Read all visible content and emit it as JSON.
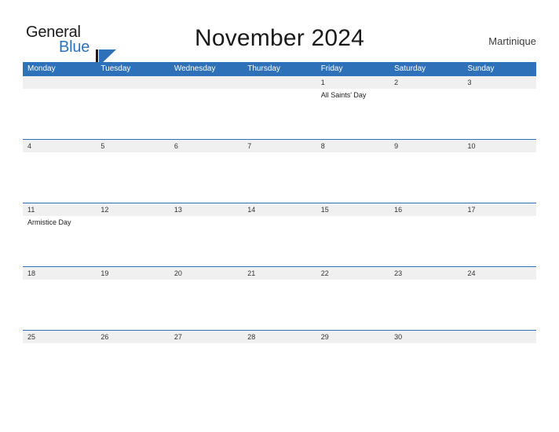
{
  "brand": {
    "name_part1": "General",
    "name_part2": "Blue",
    "logo_icon": "general-blue-triangle-logo",
    "accent_color": "#2e71b8"
  },
  "header": {
    "title": "November 2024",
    "location": "Martinique"
  },
  "calendar": {
    "weekday_headers": [
      "Monday",
      "Tuesday",
      "Wednesday",
      "Thursday",
      "Friday",
      "Saturday",
      "Sunday"
    ],
    "header_bg": "#2e71b8",
    "number_band_bg": "#f0f0f0",
    "weeks": [
      {
        "days": [
          {
            "number": "",
            "event": ""
          },
          {
            "number": "",
            "event": ""
          },
          {
            "number": "",
            "event": ""
          },
          {
            "number": "",
            "event": ""
          },
          {
            "number": "1",
            "event": "All Saints' Day"
          },
          {
            "number": "2",
            "event": ""
          },
          {
            "number": "3",
            "event": ""
          }
        ]
      },
      {
        "days": [
          {
            "number": "4",
            "event": ""
          },
          {
            "number": "5",
            "event": ""
          },
          {
            "number": "6",
            "event": ""
          },
          {
            "number": "7",
            "event": ""
          },
          {
            "number": "8",
            "event": ""
          },
          {
            "number": "9",
            "event": ""
          },
          {
            "number": "10",
            "event": ""
          }
        ]
      },
      {
        "days": [
          {
            "number": "11",
            "event": "Armistice Day"
          },
          {
            "number": "12",
            "event": ""
          },
          {
            "number": "13",
            "event": ""
          },
          {
            "number": "14",
            "event": ""
          },
          {
            "number": "15",
            "event": ""
          },
          {
            "number": "16",
            "event": ""
          },
          {
            "number": "17",
            "event": ""
          }
        ]
      },
      {
        "days": [
          {
            "number": "18",
            "event": ""
          },
          {
            "number": "19",
            "event": ""
          },
          {
            "number": "20",
            "event": ""
          },
          {
            "number": "21",
            "event": ""
          },
          {
            "number": "22",
            "event": ""
          },
          {
            "number": "23",
            "event": ""
          },
          {
            "number": "24",
            "event": ""
          }
        ]
      },
      {
        "days": [
          {
            "number": "25",
            "event": ""
          },
          {
            "number": "26",
            "event": ""
          },
          {
            "number": "27",
            "event": ""
          },
          {
            "number": "28",
            "event": ""
          },
          {
            "number": "29",
            "event": ""
          },
          {
            "number": "30",
            "event": ""
          },
          {
            "number": "",
            "event": ""
          }
        ]
      }
    ]
  }
}
